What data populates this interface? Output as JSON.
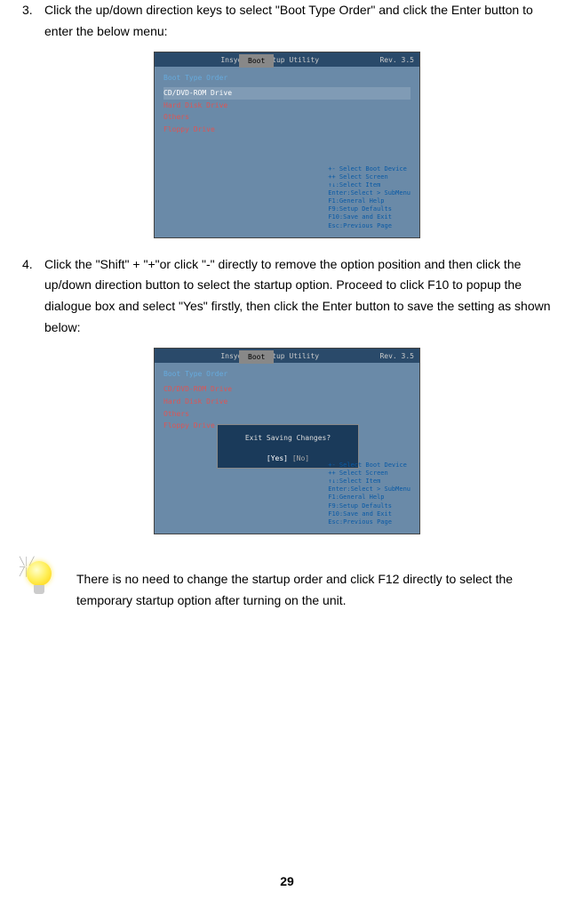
{
  "step3": {
    "num": "3.",
    "text": "Click the up/down direction keys to select \"Boot Type Order\" and click the Enter button to enter the below menu:"
  },
  "step4": {
    "num": "4.",
    "text": "Click the \"Shift\" + \"+\"or click \"-\" directly to remove the option position and then click the up/down direction button to select the startup option. Proceed to click F10 to popup the dialogue box and select \"Yes\" firstly, then click the Enter button to save the setting as shown below:"
  },
  "bios1": {
    "top_left": "",
    "top_center": "InsydeH20 Setup Utility",
    "top_right": "Rev. 3.5",
    "tab": "Boot",
    "title": "Boot Type Order",
    "item1": "CD/DVD-ROM Drive",
    "item2": "Hard Disk Drive",
    "item3": "Others",
    "item4": "Floppy Drive",
    "help1": "+-    Select Boot Device",
    "help2": "++    Select Screen",
    "help3": "↑↓:Select Item",
    "help4": "Enter:Select > SubMenu",
    "help5": "F1:General Help",
    "help6": "F9:Setup Defaults",
    "help7": "F10:Save and Exit",
    "help8": "Esc:Previous Page"
  },
  "bios2": {
    "top_center": "InsydeH20 Setup Utility",
    "top_right": "Rev. 3.5",
    "tab": "Boot",
    "title": "Boot Type Order",
    "item1": "CD/DVD-ROM Drive",
    "item2": "Hard Disk Drive",
    "item3": "Others",
    "item4": "Floppy Drive",
    "dialog_text": "Exit Saving Changes?",
    "yes": "[Yes]",
    "no": "[No]",
    "help1": "+-    Select Boot Device",
    "help2": "++    Select Screen",
    "help3": "↑↓:Select Item",
    "help4": "Enter:Select > SubMenu",
    "help5": "F1:General Help",
    "help6": "F9:Setup Defaults",
    "help7": "F10:Save and Exit",
    "help8": "Esc:Previous Page"
  },
  "tip": {
    "text": "There is no need to change the startup order and click F12 directly to select the temporary startup option after turning on the unit."
  },
  "page": "29"
}
